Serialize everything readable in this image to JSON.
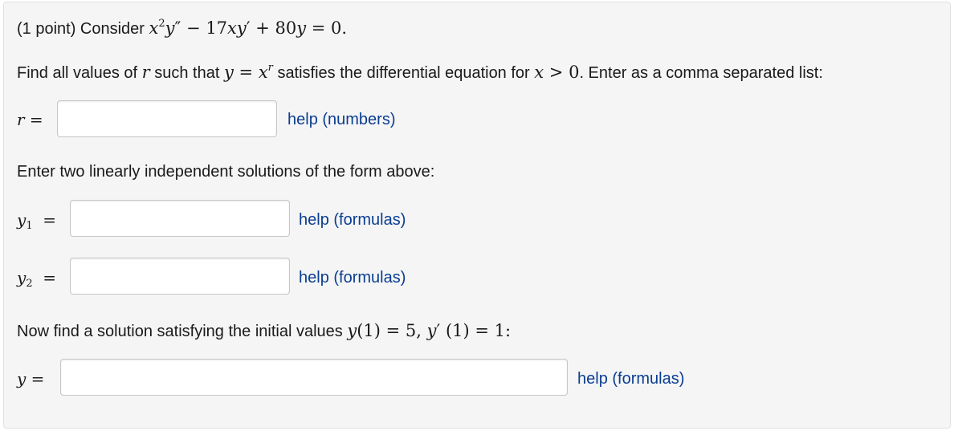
{
  "problem": {
    "intro": "(1 point) Consider",
    "part1_prefix": "Find all values of",
    "part1_middle": "such that",
    "part1_suffix": "satisfies the differential equation for",
    "part1_end": ". Enter as a comma separated list:",
    "part2_text": "Enter two linearly independent solutions of the form above:",
    "part3_prefix": "Now find a solution satisfying the initial values"
  },
  "inputs": {
    "r": {
      "value": "",
      "help": "help (numbers)"
    },
    "y1": {
      "value": "",
      "help": "help (formulas)"
    },
    "y2": {
      "value": "",
      "help": "help (formulas)"
    },
    "y": {
      "value": "",
      "help": "help (formulas)"
    }
  }
}
